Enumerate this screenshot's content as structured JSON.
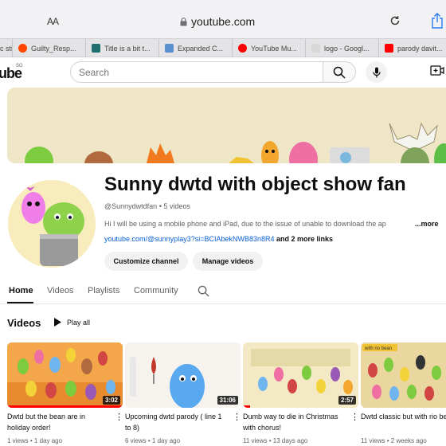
{
  "browser": {
    "text_size_label": "AA",
    "url": "youtube.com",
    "tabs": [
      {
        "label": "c sti",
        "icon": "partial-tab",
        "color": "#9a9a9a"
      },
      {
        "label": "Guilty_Resp...",
        "icon": "reddit-icon",
        "color": "#ff4500"
      },
      {
        "label": "Title is a bit t...",
        "icon": "fandom-icon",
        "color": "#1f6f6f"
      },
      {
        "label": "Expanded C...",
        "icon": "wiki-icon",
        "color": "#5b8fd0"
      },
      {
        "label": "YouTube Mu...",
        "icon": "youtube-music-icon",
        "color": "#ff0000"
      },
      {
        "label": "logo - Googl...",
        "icon": "google-icon",
        "color": "#cfcfcf"
      },
      {
        "label": "parody davit...",
        "icon": "youtube-icon",
        "color": "#ff0000"
      }
    ]
  },
  "header": {
    "logo_text": "ube",
    "logo_region": "SG",
    "search_placeholder": "Search"
  },
  "channel": {
    "name": "Sunny dwtd with object show fan",
    "handle": "@Sunnydwtdfan",
    "separator": " • ",
    "video_count": "5 videos",
    "description": "Hi I will be using a mobile phone and iPad, due to the issue of unable to download the ap",
    "more_label": "...more",
    "link": "youtube.com/@sunnyplay3?si=BCIAbekNWB83n8R4",
    "more_links": "and 2 more links",
    "customize_label": "Customize channel",
    "manage_label": "Manage videos"
  },
  "nav_tabs": [
    "Home",
    "Videos",
    "Playlists",
    "Community"
  ],
  "shelf": {
    "title": "Videos",
    "play_all": "Play all"
  },
  "videos": [
    {
      "title": "Dwtd but the bean are in holiday order!",
      "meta": "1 views • 1 day ago",
      "duration": "3:02",
      "progress": 1.0
    },
    {
      "title": "Upcoming dwtd parody ( line 1 to 8)",
      "meta": "6 views • 1 day ago",
      "duration": "31:06",
      "progress": 0.0
    },
    {
      "title": "Dumb way to die in Christmas with chorus!",
      "meta": "11 views • 13 days ago",
      "duration": "2:57",
      "progress": 0.06
    },
    {
      "title": "Dwtd classic but with rio bean!",
      "meta": "11 views • 2 weeks ago",
      "duration": "",
      "progress": 0.0
    }
  ],
  "thumb_badge_text": "with rio bean"
}
